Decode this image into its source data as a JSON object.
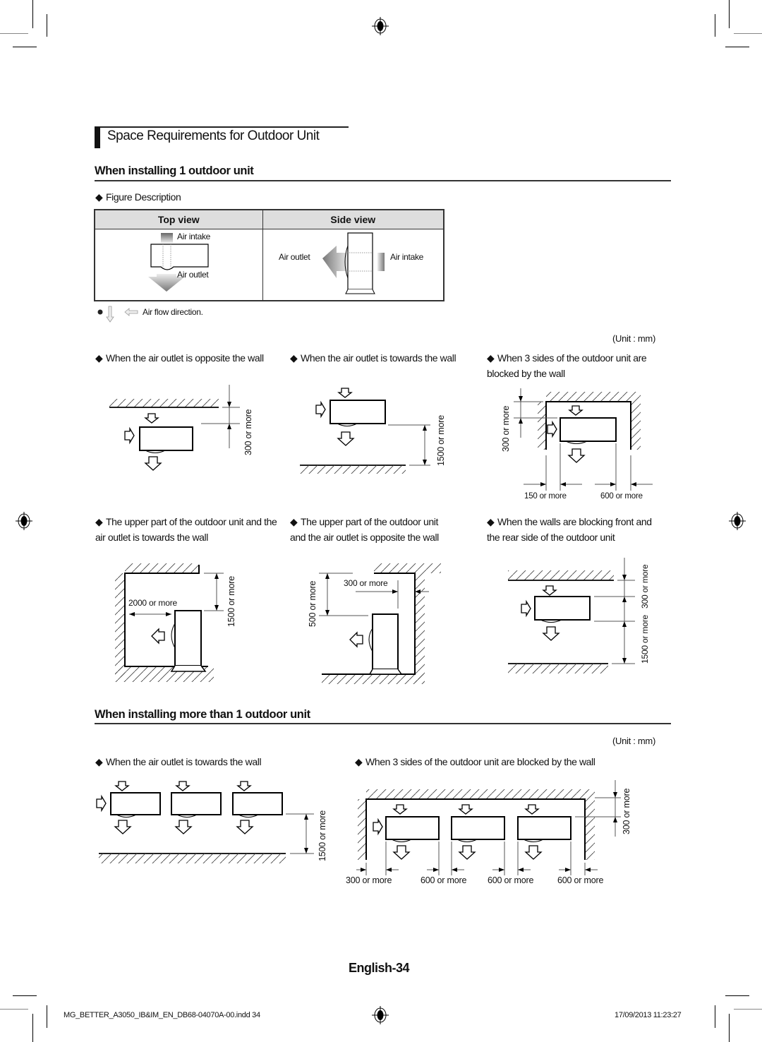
{
  "section_title": "Space Requirements for Outdoor Unit",
  "single": {
    "heading": "When installing 1 outdoor unit",
    "figure_description": "Figure Description",
    "table": {
      "headers": [
        "Top view",
        "Side view"
      ],
      "top_view": {
        "intake": "Air intake",
        "outlet": "Air outlet"
      },
      "side_view": {
        "outlet": "Air outlet",
        "intake": "Air intake"
      }
    },
    "note": "Air flow direction.",
    "unit_label": "(Unit : mm)",
    "cases": [
      {
        "text": "When the air outlet is opposite the wall",
        "dims": [
          "300 or more"
        ]
      },
      {
        "text": "When the air outlet is towards the wall",
        "dims": [
          "1500 or more"
        ]
      },
      {
        "text": "When 3 sides of the outdoor unit are blocked by the wall",
        "dims": [
          "300 or more",
          "150 or more",
          "600 or more"
        ]
      },
      {
        "text": "The upper part of the outdoor unit and the air outlet is towards the wall",
        "dims": [
          "2000 or more",
          "1500 or more"
        ]
      },
      {
        "text": "The upper part of the outdoor unit and the air outlet is opposite the wall",
        "dims": [
          "300 or more",
          "500 or more"
        ]
      },
      {
        "text": "When the walls are blocking front and the rear side of the outdoor unit",
        "dims": [
          "300 or more",
          "1500 or more"
        ]
      }
    ]
  },
  "multi": {
    "heading": "When installing more than 1 outdoor unit",
    "unit_label": "(Unit : mm)",
    "cases": [
      {
        "text": "When the air outlet is towards the wall",
        "dims": [
          "1500 or more"
        ]
      },
      {
        "text": "When 3 sides of the outdoor unit are blocked by the wall",
        "dims": [
          "300 or more",
          "300 or more",
          "600 or more",
          "600 or more",
          "600 or more"
        ]
      }
    ]
  },
  "page_label": "English-34",
  "footer": {
    "file": "MG_BETTER_A3050_IB&IM_EN_DB68-04070A-00.indd   34",
    "datetime": "17/09/2013   11:23:27"
  }
}
